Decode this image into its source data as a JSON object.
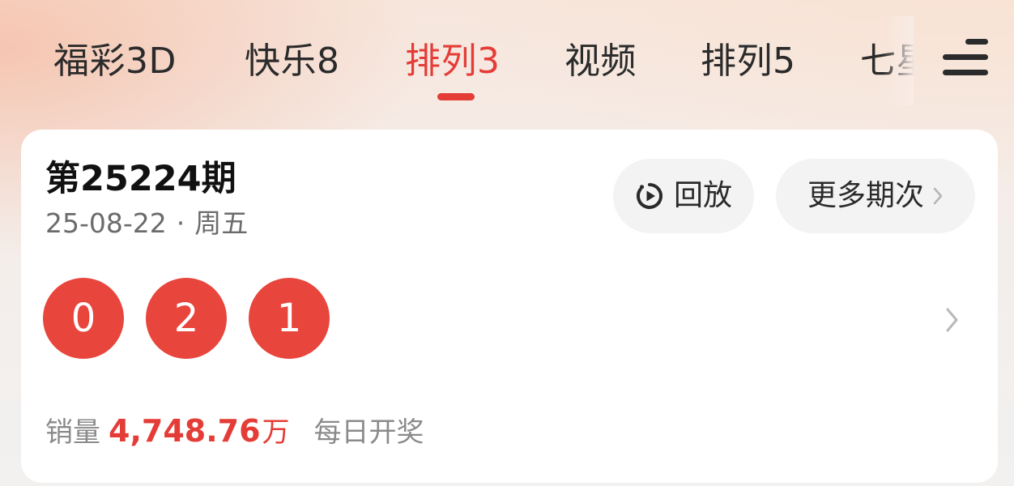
{
  "tabs": {
    "items": [
      {
        "label": "福彩3D",
        "active": false
      },
      {
        "label": "快乐8",
        "active": false
      },
      {
        "label": "排列3",
        "active": true
      },
      {
        "label": "视频",
        "active": false
      },
      {
        "label": "排列5",
        "active": false
      },
      {
        "label": "七星彩",
        "active": false
      }
    ],
    "menu_icon": "hamburger-menu-icon",
    "accent_color": "#e43d37"
  },
  "draw": {
    "issue_title": "第25224期",
    "date": "25-08-22",
    "separator": "·",
    "weekday": "周五",
    "replay_label": "回放",
    "replay_icon": "replay-clock-icon",
    "more_label": "更多期次",
    "more_icon": "chevron-right-icon",
    "numbers": [
      "0",
      "2",
      "1"
    ],
    "ball_color": "#e8453c",
    "sales_label": "销量",
    "sales_value": "4,748.76",
    "sales_unit": "万",
    "frequency": "每日开奖"
  }
}
